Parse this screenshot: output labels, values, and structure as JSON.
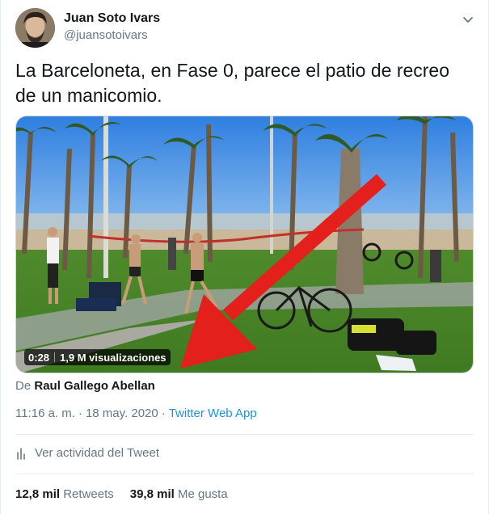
{
  "author": {
    "name": "Juan Soto Ivars",
    "handle": "@juansotoivars"
  },
  "tweet": {
    "text": "La Barceloneta, en Fase 0, parece el patio de recreo de un manicomio."
  },
  "video": {
    "duration": "0:28",
    "views": "1,9 M visualizaciones"
  },
  "attribution": {
    "prefix": "De",
    "name": "Raul Gallego Abellan"
  },
  "meta": {
    "time": "11:16 a. m.",
    "separator": "·",
    "date": "18 may. 2020",
    "source": "Twitter Web App"
  },
  "activity": {
    "label": "Ver actividad del Tweet"
  },
  "stats": {
    "retweets_count": "12,8 mil",
    "retweets_label": "Retweets",
    "likes_count": "39,8 mil",
    "likes_label": "Me gusta"
  },
  "colors": {
    "link": "#1b95e0",
    "secondary_text": "#657786",
    "arrow": "#e3201b"
  }
}
